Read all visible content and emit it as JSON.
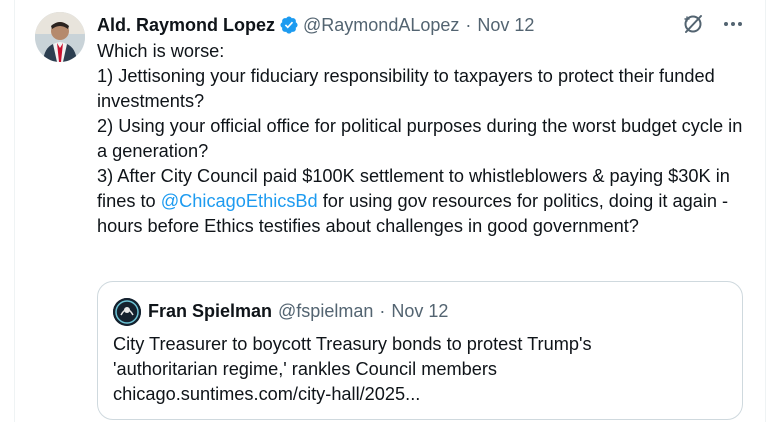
{
  "tweet": {
    "author_name": "Ald. Raymond Lopez",
    "author_handle": "@RaymondALopez",
    "separator": "·",
    "date": "Nov 12",
    "lines": {
      "l1": "Which is worse:",
      "l2": "1) Jettisoning your fiduciary responsibility to taxpayers to protect their funded investments?",
      "l3": "2) Using your official office for political purposes during the worst budget cycle in a generation?",
      "l4a": "3) After City Council paid $100K settlement to whistleblowers & paying $30K in fines to ",
      "mention": "@ChicagoEthicsBd",
      "l4b": " for using gov resources for politics, doing it again - hours before Ethics testifies about challenges in good government?"
    }
  },
  "quote": {
    "author_name": "Fran Spielman",
    "author_handle": "@fspielman",
    "separator": "·",
    "date": "Nov 12",
    "line1": "City Treasurer to boycott Treasury bonds to protest Trump's",
    "line2": "'authoritarian regime,' rankles Council members",
    "link": "chicago.suntimes.com/city-hall/2025..."
  },
  "icons": {
    "verified": "verified-badge-icon",
    "grok": "grok-icon",
    "more": "more-icon"
  },
  "colors": {
    "text": "#0f1419",
    "secondary": "#536471",
    "link": "#1d9bf0",
    "border": "#cfd9de"
  }
}
